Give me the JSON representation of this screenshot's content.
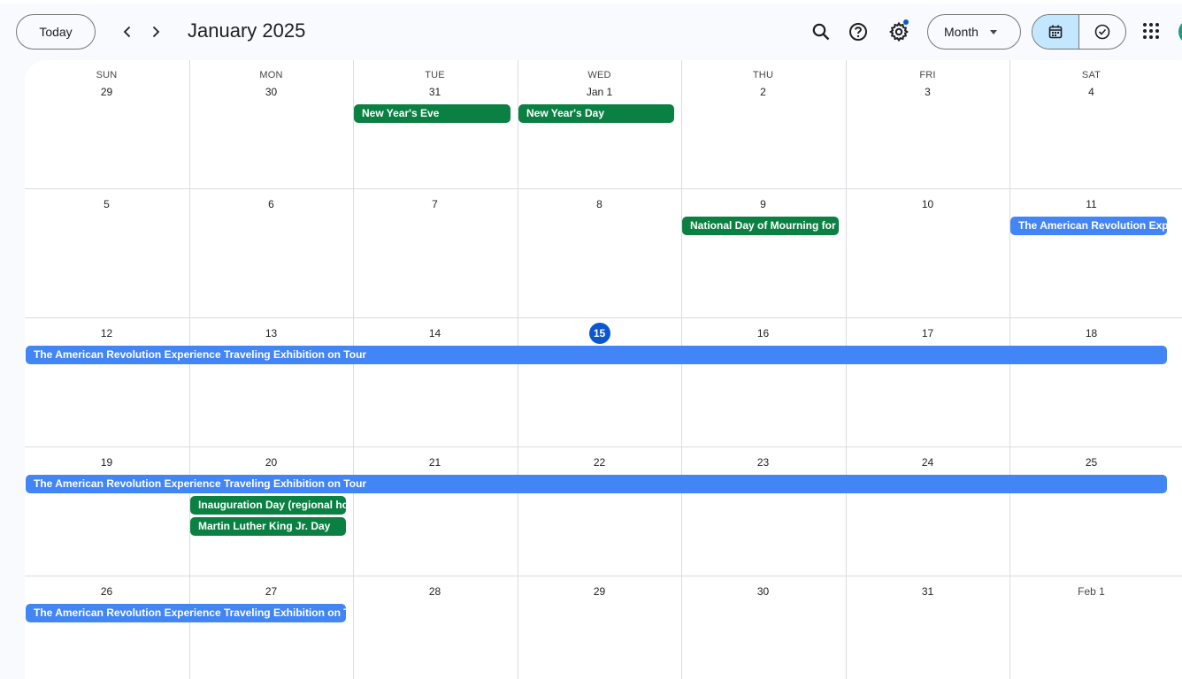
{
  "header": {
    "today_label": "Today",
    "title": "January 2025",
    "view_label": "Month",
    "icons": {
      "prev": "chevron-left-icon",
      "next": "chevron-right-icon",
      "search": "search-icon",
      "help": "help-icon",
      "settings": "gear-icon",
      "calendar_view": "calendar-icon",
      "tasks_view": "tasks-check-icon",
      "apps": "apps-grid-icon"
    }
  },
  "colors": {
    "holiday": "#0b8043",
    "exhibition": "#4285f4",
    "today": "#0b57d0",
    "selected_view": "#c2e7ff"
  },
  "weekdays": [
    "SUN",
    "MON",
    "TUE",
    "WED",
    "THU",
    "FRI",
    "SAT"
  ],
  "weeks": [
    [
      "29",
      "30",
      "31",
      "Jan 1",
      "2",
      "3",
      "4"
    ],
    [
      "5",
      "6",
      "7",
      "8",
      "9",
      "10",
      "11"
    ],
    [
      "12",
      "13",
      "14",
      "15",
      "16",
      "17",
      "18"
    ],
    [
      "19",
      "20",
      "21",
      "22",
      "23",
      "24",
      "25"
    ],
    [
      "26",
      "27",
      "28",
      "29",
      "30",
      "31",
      "Feb 1"
    ]
  ],
  "today": "15",
  "events": [
    {
      "title": "New Year's Eve",
      "week": 0,
      "day": 2,
      "span": 1,
      "slot": 0,
      "kind": "holiday"
    },
    {
      "title": "New Year's Day",
      "week": 0,
      "day": 3,
      "span": 1,
      "slot": 0,
      "kind": "holiday"
    },
    {
      "title": "National Day of Mourning for Jimmy Carter",
      "week": 1,
      "day": 4,
      "span": 1,
      "slot": 0,
      "kind": "holiday"
    },
    {
      "title": "The American Revolution Experience Traveling Exhibition on Tour",
      "week": 1,
      "day": 6,
      "span": 1,
      "slot": 0,
      "kind": "exhibition"
    },
    {
      "title": "The American Revolution Experience Traveling Exhibition on Tour",
      "week": 2,
      "day": 0,
      "span": 7,
      "slot": 0,
      "kind": "exhibition"
    },
    {
      "title": "The American Revolution Experience Traveling Exhibition on Tour",
      "week": 3,
      "day": 0,
      "span": 7,
      "slot": 0,
      "kind": "exhibition"
    },
    {
      "title": "Inauguration Day (regional holiday)",
      "week": 3,
      "day": 1,
      "span": 1,
      "slot": 1,
      "kind": "holiday"
    },
    {
      "title": "Martin Luther King Jr. Day",
      "week": 3,
      "day": 1,
      "span": 1,
      "slot": 2,
      "kind": "holiday"
    },
    {
      "title": "The American Revolution Experience Traveling Exhibition on Tour",
      "week": 4,
      "day": 0,
      "span": 2,
      "slot": 0,
      "kind": "exhibition"
    }
  ]
}
